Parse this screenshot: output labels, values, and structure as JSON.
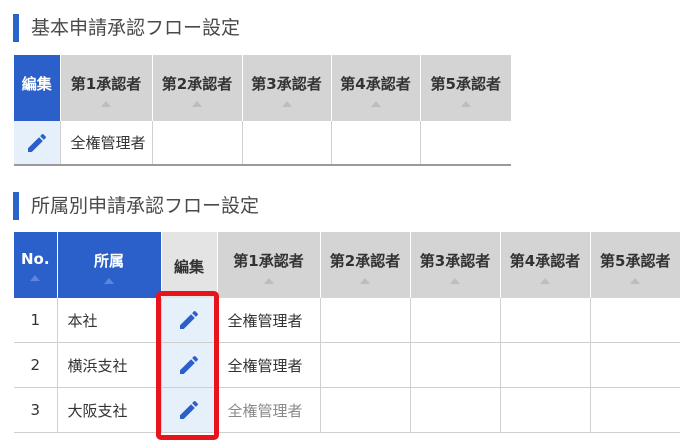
{
  "section1": {
    "title": "基本申請承認フロー設定",
    "headers": [
      "編集",
      "第1承認者",
      "第2承認者",
      "第3承認者",
      "第4承認者",
      "第5承認者"
    ],
    "row": {
      "approvers": [
        "全権管理者",
        "",
        "",
        "",
        ""
      ]
    }
  },
  "section2": {
    "title": "所属別申請承認フロー設定",
    "headers": [
      "No.",
      "所属",
      "編集",
      "第1承認者",
      "第2承認者",
      "第3承認者",
      "第4承認者",
      "第5承認者"
    ],
    "rows": [
      {
        "no": "1",
        "dept": "本社",
        "approvers": [
          "全権管理者",
          "",
          "",
          "",
          ""
        ]
      },
      {
        "no": "2",
        "dept": "横浜支社",
        "approvers": [
          "全権管理者",
          "",
          "",
          "",
          ""
        ]
      },
      {
        "no": "3",
        "dept": "大阪支社",
        "approvers": [
          "全権管理者",
          "",
          "",
          "",
          ""
        ]
      }
    ]
  },
  "colors": {
    "accent": "#2b5fca",
    "highlight": "#e8141c",
    "header_gray": "#d4d4d4",
    "edit_cell_bg": "#e6f0fb"
  },
  "icons": {
    "edit": "pencil-icon",
    "sort": "sort-up-icon"
  }
}
